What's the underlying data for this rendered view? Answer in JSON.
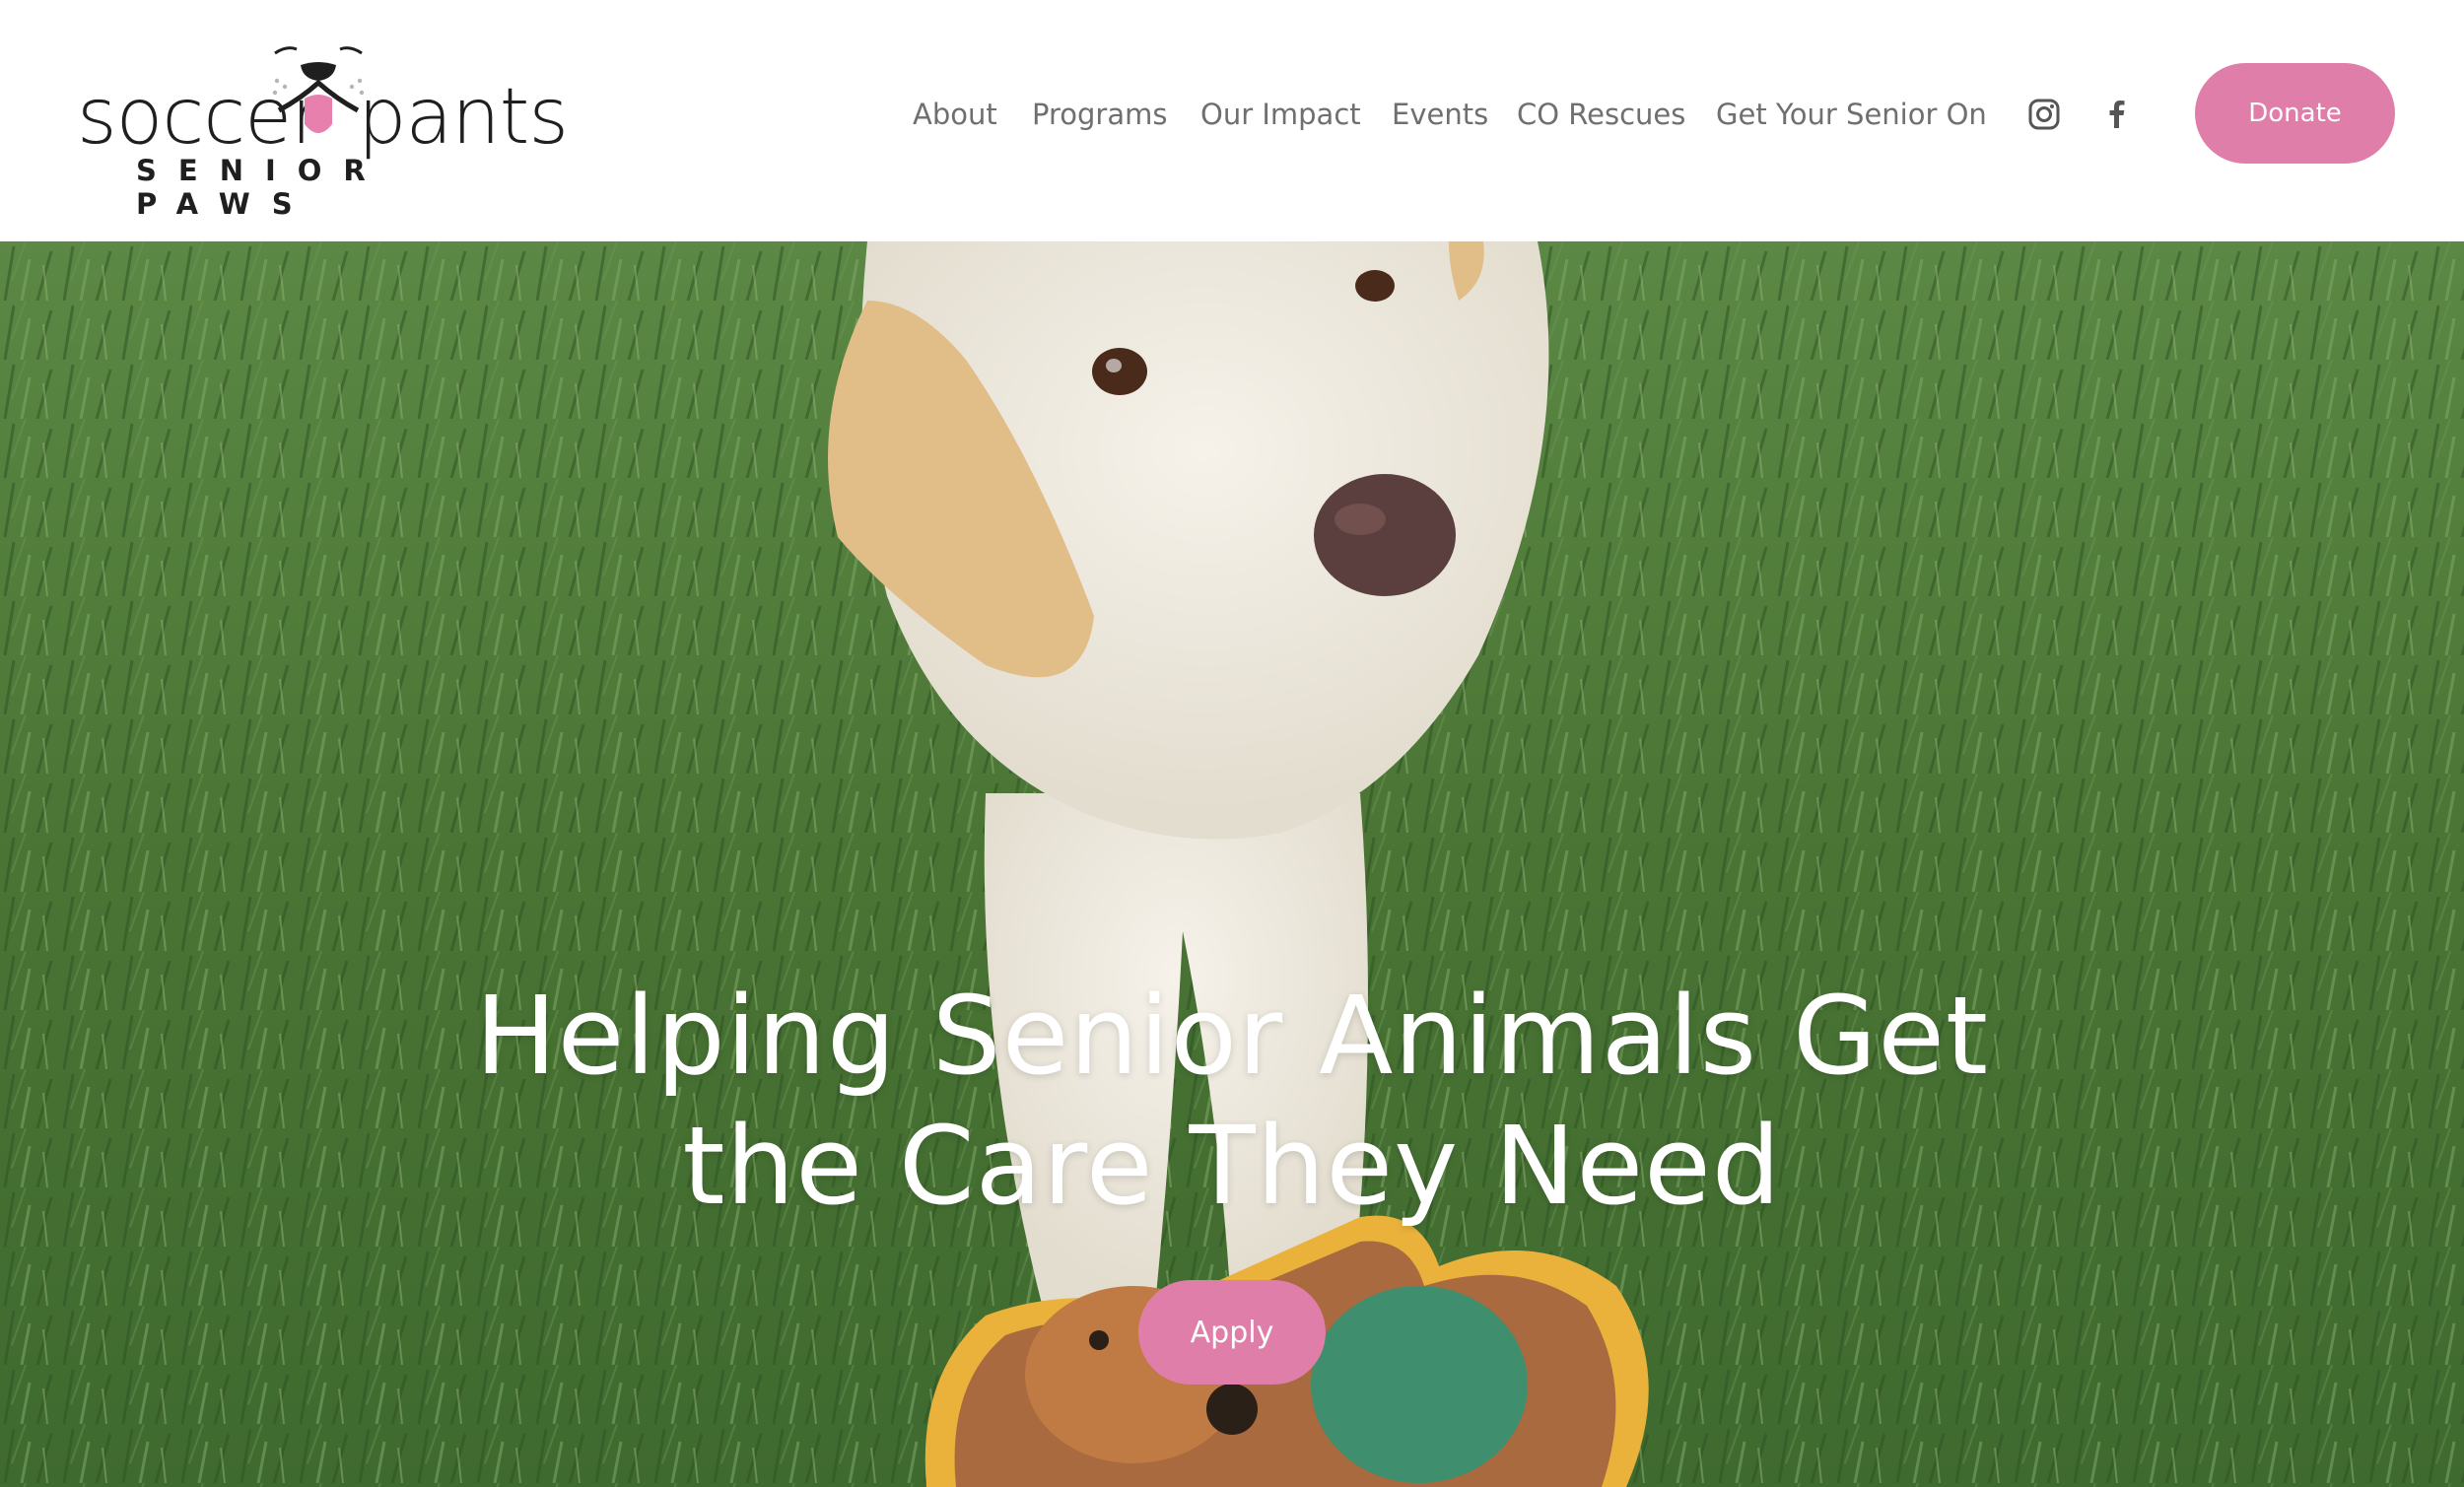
{
  "brand": {
    "name_left": "soccer",
    "name_right": "pants",
    "tagline": "SENIOR PAWS"
  },
  "nav": {
    "items": [
      {
        "label": "About"
      },
      {
        "label": "Programs"
      },
      {
        "label": "Our Impact"
      },
      {
        "label": "Events"
      },
      {
        "label": "CO Rescues"
      },
      {
        "label": "Get Your Senior On"
      }
    ]
  },
  "social": {
    "icons": [
      "instagram-icon",
      "facebook-icon"
    ]
  },
  "header": {
    "donate_label": "Donate"
  },
  "hero": {
    "title_line1": "Helping Senior Animals Get",
    "title_line2": "the Care They Need",
    "apply_label": "Apply"
  },
  "colors": {
    "accent": "#df7ea8",
    "nav_text": "#6f6f6f",
    "logo_text": "#1f1f1f",
    "grass": "#4c7536"
  }
}
